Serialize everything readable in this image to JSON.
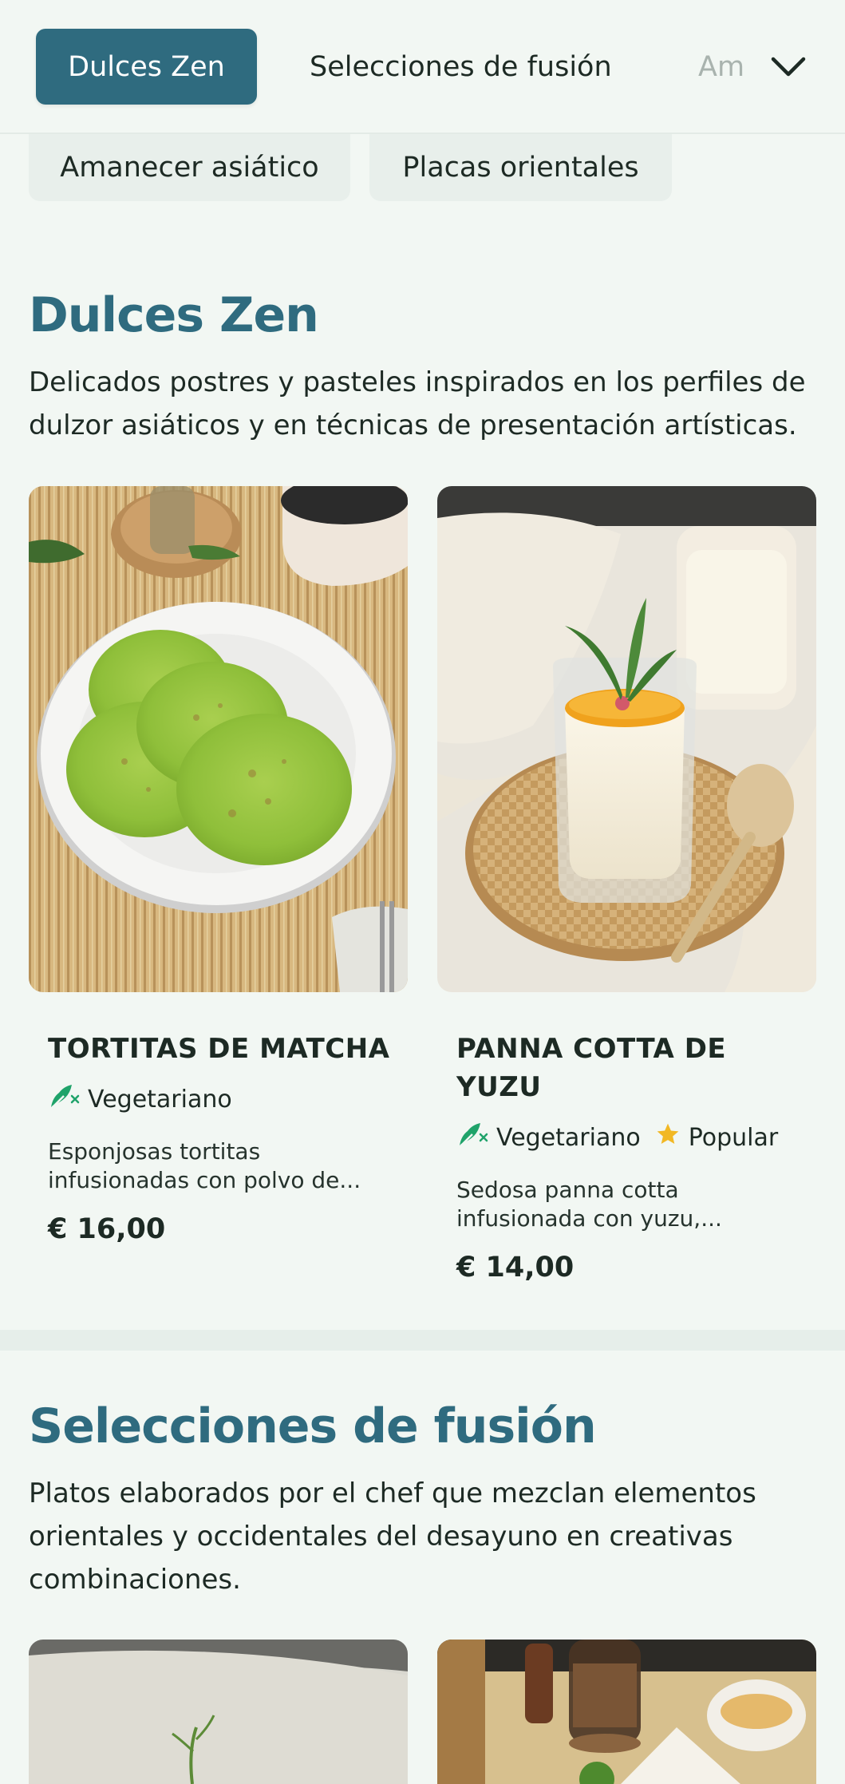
{
  "nav": {
    "active_tab": "Dulces Zen",
    "tabs": [
      "Dulces Zen",
      "Selecciones de fusión",
      "Am"
    ],
    "overflow_tabs": [
      "Amanecer asiático",
      "Placas orientales"
    ],
    "expand_icon": "chevron-down-icon"
  },
  "sections": [
    {
      "title": "Dulces Zen",
      "description": "Delicados postres y pasteles inspirados en los perfiles de dulzor asiáticos y en técnicas de presentación artísticas.",
      "items": [
        {
          "name": "TORTITAS DE MATCHA",
          "tags": [
            {
              "label": "Vegetariano",
              "icon": "vegetarian-icon"
            }
          ],
          "description": "Esponjosas tortitas infusionadas con polvo de...",
          "price": "€ 16,00"
        },
        {
          "name": "PANNA COTTA DE YUZU",
          "tags": [
            {
              "label": "Vegetariano",
              "icon": "vegetarian-icon"
            },
            {
              "label": "Popular",
              "icon": "star-icon"
            }
          ],
          "description": "Sedosa panna cotta infusionada con yuzu,...",
          "price": "€ 14,00"
        }
      ]
    },
    {
      "title": "Selecciones de fusión",
      "description": "Platos elaborados por el chef que mezclan elementos orientales y occidentales del desayuno en creativas combinaciones."
    }
  ],
  "colors": {
    "accent": "#2f6b7f",
    "background": "#f2f7f3",
    "vegetarian": "#1fa36a",
    "star": "#f2b824"
  }
}
